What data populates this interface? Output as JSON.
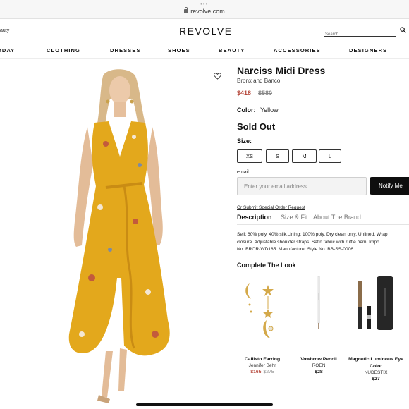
{
  "browser": {
    "url": "revolve.com"
  },
  "header": {
    "left_text": "auty",
    "logo": "REVOLVE",
    "search_placeholder": "Search"
  },
  "nav": [
    "ODAY",
    "CLOTHING",
    "DRESSES",
    "SHOES",
    "BEAUTY",
    "ACCESSORIES",
    "DESIGNERS"
  ],
  "product": {
    "title": "Narciss Midi Dress",
    "brand": "Bronx and Banco",
    "price": "$418",
    "original_price": "$580",
    "color_label": "Color:",
    "color_value": "Yellow",
    "availability": "Sold Out",
    "size_label": "Size:",
    "sizes": [
      "XS",
      "S",
      "M",
      "L"
    ],
    "email_label": "email",
    "email_placeholder": "Enter your email address",
    "notify_label": "Notify Me",
    "special_order_link": "Or Submit Special Order Request",
    "tabs": [
      "Description",
      "Size & Fit",
      "About The Brand"
    ],
    "description_lines": [
      "Self: 60% poly, 40% silk.Lining: 100% poly. Dry clean only. Unlined. Wrap",
      "closure. Adjustable shoulder straps. Satin fabric with ruffle hem. Impo",
      "No. BROR-WD185. Manufacturer Style No. BB-SS-0006."
    ]
  },
  "complete_the_look": {
    "title": "Complete The Look",
    "items": [
      {
        "name": "Callisto Earring",
        "brand": "Jennifer Behr",
        "price": "$165",
        "original_price": "$275"
      },
      {
        "name": "Vowbrow Pencil",
        "brand": "ROEN",
        "price": "$28"
      },
      {
        "name": "Magnetic Luminous Eye Color",
        "brand": "NUDESTIX",
        "price": "$27"
      }
    ]
  },
  "colors": {
    "sale_price": "#b5473a",
    "dress_yellow": "#e3a81c",
    "button_black": "#0e0e0e"
  }
}
